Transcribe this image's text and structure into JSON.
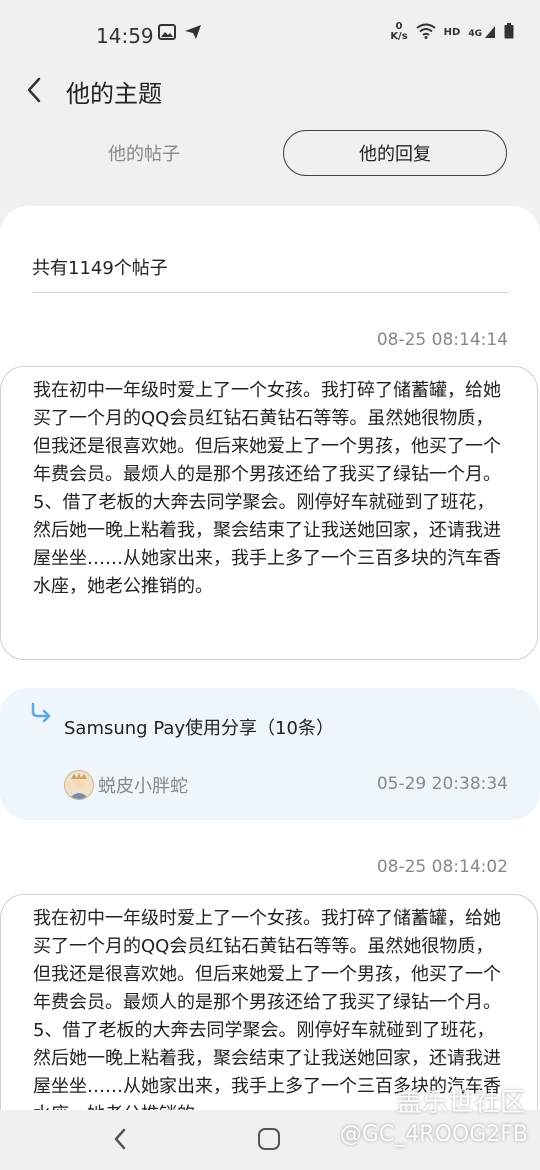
{
  "status": {
    "time": "14:59",
    "speed_value": "0",
    "speed_unit": "K/s",
    "hd": "HD",
    "network": "4G"
  },
  "header": {
    "title": "他的主题"
  },
  "tabs": [
    {
      "label": "他的帖子",
      "selected": false
    },
    {
      "label": "他的回复",
      "selected": true
    }
  ],
  "summary": {
    "count_text": "共有1149个帖子"
  },
  "replies": [
    {
      "time": "08-25 08:14:14",
      "text": "我在初中一年级时爱上了一个女孩。我打碎了储蓄罐，给她买了一个月的QQ会员红钻石黄钻石等等。虽然她很物质，但我还是很喜欢她。但后来她爱上了一个男孩，他买了一个年费会员。最烦人的是那个男孩还给了我买了绿钻一个月。\n5、借了老板的大奔去同学聚会。刚停好车就碰到了班花，然后她一晚上粘着我，聚会结束了让我送她回家，还请我进屋坐坐……从她家出来，我手上多了一个三百多块的汽车香水座，她老公推销的。"
    },
    {
      "time": "08-25 08:14:02",
      "text": "我在初中一年级时爱上了一个女孩。我打碎了储蓄罐，给她买了一个月的QQ会员红钻石黄钻石等等。虽然她很物质，但我还是很喜欢她。但后来她爱上了一个男孩，他买了一个年费会员。最烦人的是那个男孩还给了我买了绿钻一个月。\n5、借了老板的大奔去同学聚会。刚停好车就碰到了班花，然后她一晚上粘着我，聚会结束了让我送她回家，还请我进屋坐坐……从她家出来，我手上多了一个三百多块的汽车香水座，她老公推销的。"
    }
  ],
  "quoted_post": {
    "title": "Samsung Pay使用分享（10条）",
    "author": "蜕皮小胖蛇",
    "time": "05-29 20:38:34"
  },
  "watermark": {
    "line1": "盖乐世社区",
    "line2": "@GC_4ROOG2FB"
  },
  "colors": {
    "background": "#f0f0f0",
    "card": "#ffffff",
    "quoted_bg": "#eef6fb",
    "reply_icon": "#5aa9e6",
    "muted_text": "#888888"
  }
}
